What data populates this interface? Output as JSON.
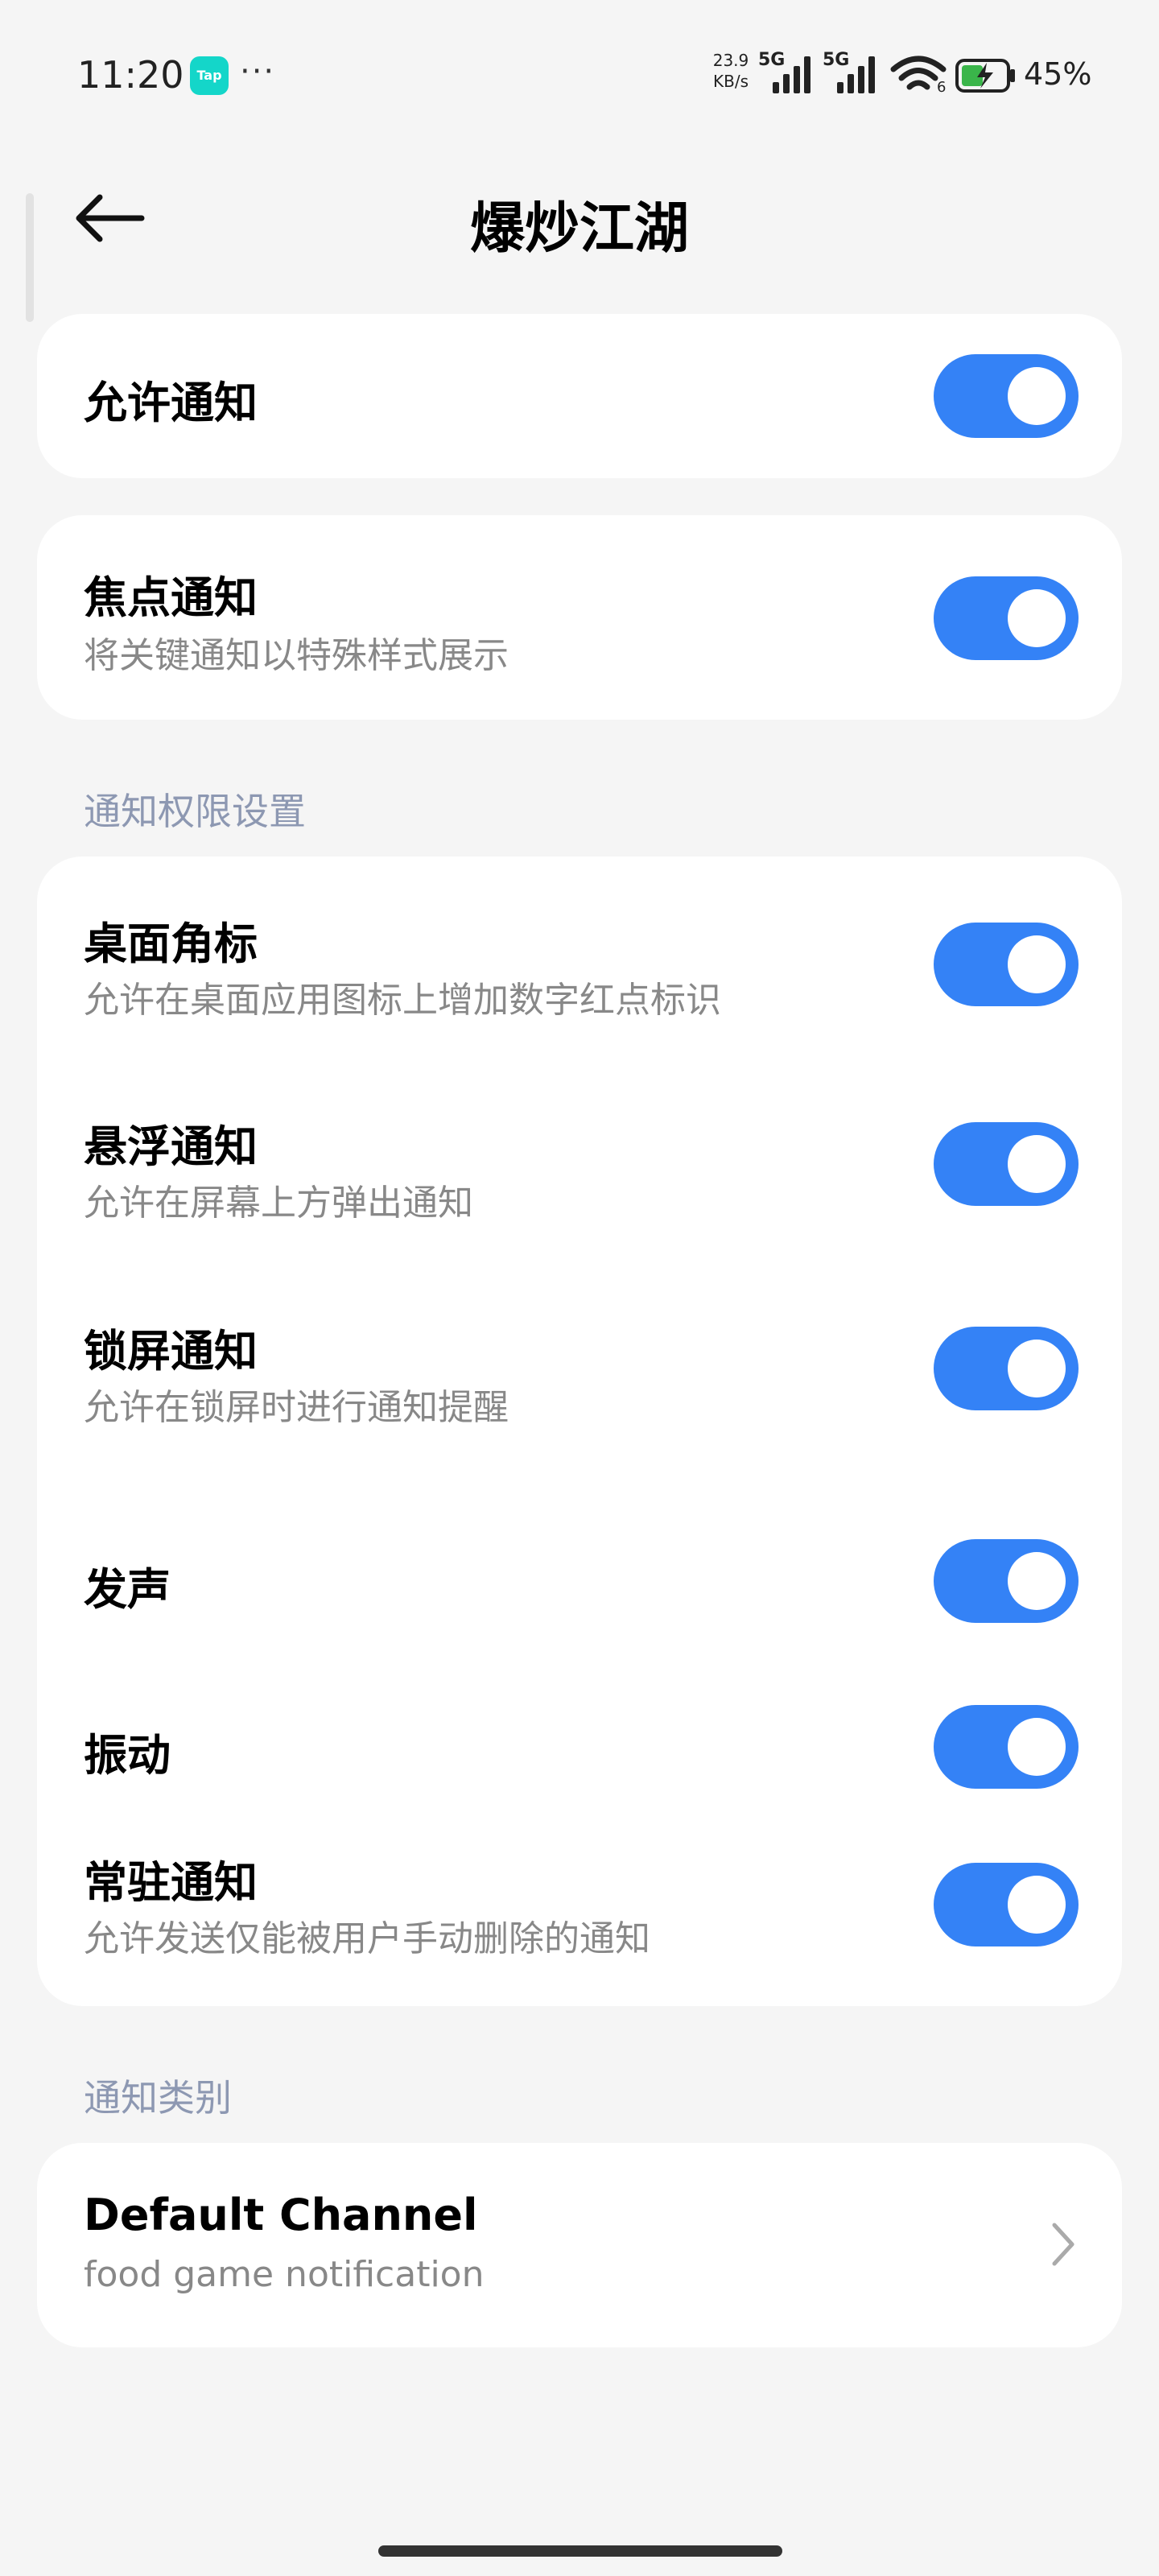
{
  "status_bar": {
    "time": "11:20",
    "tap_badge": "Tap",
    "dots": "···",
    "net_speed_value": "23.9",
    "net_speed_unit": "KB/s",
    "sim1": "5G",
    "sim2": "5G",
    "wifi_label": "6",
    "battery": "45%",
    "icons": [
      "tap-app-icon",
      "signal-icon",
      "wifi-icon",
      "battery-charging-icon"
    ]
  },
  "header": {
    "title": "爆炒江湖",
    "back_icon": "back-arrow-icon"
  },
  "allow": {
    "title": "允许通知",
    "enabled": true
  },
  "focus": {
    "title": "焦点通知",
    "subtitle": "将关键通知以特殊样式展示",
    "enabled": true
  },
  "permissions": {
    "header": "通知权限设置",
    "items": [
      {
        "title": "桌面角标",
        "subtitle": "允许在桌面应用图标上增加数字红点标识",
        "enabled": true
      },
      {
        "title": "悬浮通知",
        "subtitle": "允许在屏幕上方弹出通知",
        "enabled": true
      },
      {
        "title": "锁屏通知",
        "subtitle": "允许在锁屏时进行通知提醒",
        "enabled": true
      },
      {
        "title": "发声",
        "subtitle": "",
        "enabled": true
      },
      {
        "title": "振动",
        "subtitle": "",
        "enabled": true
      },
      {
        "title": "常驻通知",
        "subtitle": "允许发送仅能被用户手动删除的通知",
        "enabled": true
      }
    ]
  },
  "categories": {
    "header": "通知类别",
    "items": [
      {
        "title": "Default Channel",
        "subtitle": "food game notification",
        "icon": "chevron-right-icon"
      }
    ]
  },
  "colors": {
    "toggle_on": "#3482f6",
    "background": "#f5f5f5",
    "card": "#ffffff",
    "section_header": "#8d98b2",
    "subtitle": "#888888"
  }
}
